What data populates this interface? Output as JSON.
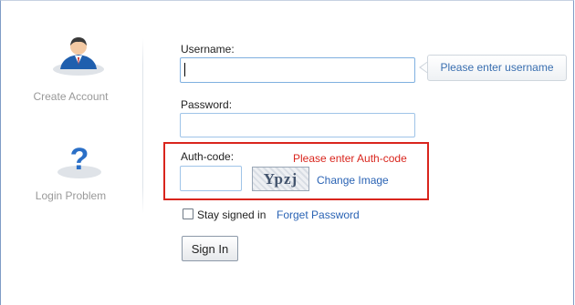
{
  "sidebar": {
    "create_account": "Create Account",
    "login_problem": "Login Problem",
    "user_icon": "user-avatar-icon",
    "help_icon": "question-mark-icon"
  },
  "form": {
    "username_label": "Username:",
    "username_value": "",
    "username_tooltip": "Please enter username",
    "password_label": "Password:",
    "password_value": "",
    "authcode_label": "Auth-code:",
    "authcode_value": "",
    "authcode_error": "Please enter Auth-code",
    "captcha_text": "Ypzj",
    "change_image": "Change Image",
    "stay_signed_in": "Stay signed in",
    "stay_signed_in_checked": false,
    "forget_password": "Forget Password",
    "sign_in": "Sign In"
  },
  "colors": {
    "link": "#2a63b4",
    "error": "#d9251d",
    "input_border": "#9fc4e8",
    "muted_text": "#999999"
  }
}
